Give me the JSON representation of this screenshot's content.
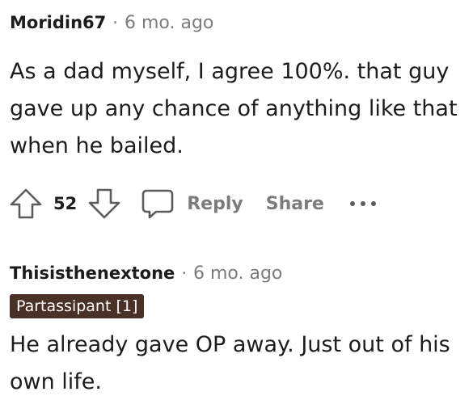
{
  "comments": [
    {
      "author": "Moridin67",
      "separator": "·",
      "time": "6 mo. ago",
      "body": "As a dad myself, I agree 100%. that guy gave up any chance of anything like that when he bailed."
    },
    {
      "author": "Thisisthenextone",
      "separator": "·",
      "time": "6 mo. ago",
      "flair": "Partassipant [1]",
      "body": "He already gave OP away. Just out of his own life."
    }
  ],
  "actions": {
    "score": "52",
    "reply_label": "Reply",
    "share_label": "Share",
    "icons": {
      "upvote": "arrow-up-outline-icon",
      "downvote": "arrow-down-outline-icon",
      "reply": "speech-bubble-icon",
      "more": "ellipsis-icon"
    }
  },
  "colors": {
    "text": "#1c1c1c",
    "muted": "#7c7c7c",
    "flair_bg": "#4a3126",
    "flair_text": "#ffffff"
  }
}
